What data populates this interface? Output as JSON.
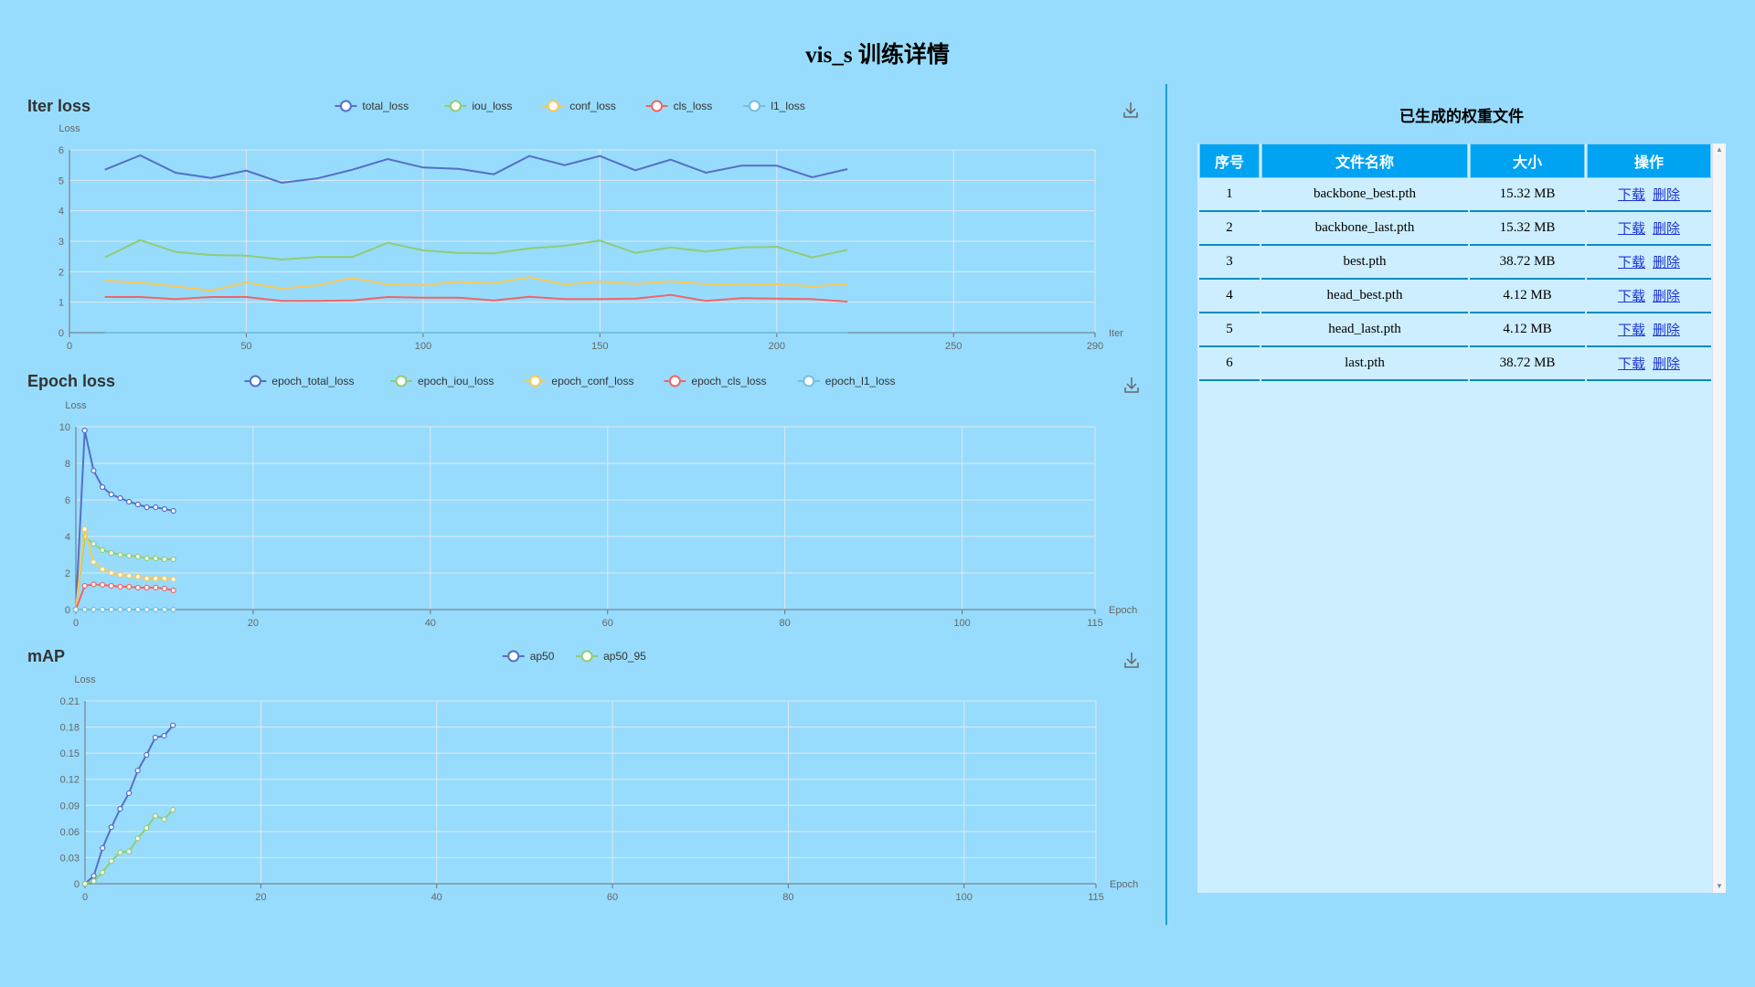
{
  "page": {
    "title": "vis_s 训练详情"
  },
  "colors": {
    "blue": "#5470c6",
    "green": "#91cc75",
    "yellow": "#fac858",
    "red": "#ee6666",
    "cyan": "#73c0de",
    "background": "#97dcfd",
    "header": "#00a3f2"
  },
  "charts": [
    {
      "title": "Iter loss",
      "chart_data": {
        "type": "line",
        "ylabel": "Loss",
        "xlabel": "Iter",
        "x_ticks": [
          "0",
          "50",
          "100",
          "150",
          "200",
          "250",
          "290"
        ],
        "y_ticks": [
          "0",
          "1",
          "2",
          "3",
          "4",
          "5",
          "6"
        ],
        "xlim": [
          0,
          290
        ],
        "ylim": [
          0,
          6
        ],
        "x": [
          10,
          20,
          30,
          40,
          50,
          60,
          70,
          80,
          90,
          100,
          110,
          120,
          130,
          140,
          150,
          160,
          170,
          180,
          190,
          200,
          210,
          220
        ],
        "series": [
          {
            "name": "total_loss",
            "color": "#5470c6",
            "values": [
              5.35,
              5.82,
              5.25,
              5.08,
              5.32,
              4.92,
              5.06,
              5.35,
              5.7,
              5.42,
              5.38,
              5.2,
              5.8,
              5.5,
              5.8,
              5.33,
              5.68,
              5.25,
              5.48,
              5.48,
              5.1,
              5.37
            ]
          },
          {
            "name": "iou_loss",
            "color": "#91cc75",
            "values": [
              2.47,
              3.04,
              2.65,
              2.55,
              2.53,
              2.4,
              2.48,
              2.48,
              2.95,
              2.7,
              2.62,
              2.6,
              2.77,
              2.85,
              3.02,
              2.62,
              2.8,
              2.66,
              2.8,
              2.82,
              2.47,
              2.72
            ]
          },
          {
            "name": "conf_loss",
            "color": "#fac858",
            "values": [
              1.7,
              1.64,
              1.52,
              1.38,
              1.65,
              1.45,
              1.55,
              1.8,
              1.58,
              1.55,
              1.67,
              1.62,
              1.82,
              1.58,
              1.68,
              1.6,
              1.68,
              1.6,
              1.57,
              1.6,
              1.52,
              1.6
            ]
          },
          {
            "name": "cls_loss",
            "color": "#ee6666",
            "values": [
              1.17,
              1.17,
              1.1,
              1.17,
              1.17,
              1.04,
              1.04,
              1.06,
              1.17,
              1.15,
              1.15,
              1.06,
              1.18,
              1.1,
              1.1,
              1.12,
              1.24,
              1.04,
              1.13,
              1.12,
              1.1,
              1.02
            ]
          },
          {
            "name": "l1_loss",
            "color": "#73c0de",
            "values": [
              0,
              0,
              0,
              0,
              0,
              0,
              0,
              0,
              0,
              0,
              0,
              0,
              0,
              0,
              0,
              0,
              0,
              0,
              0,
              0,
              0,
              0
            ]
          }
        ],
        "show_symbols": false
      }
    },
    {
      "title": "Epoch loss",
      "chart_data": {
        "type": "line",
        "ylabel": "Loss",
        "xlabel": "Epoch",
        "x_ticks": [
          "0",
          "20",
          "40",
          "60",
          "80",
          "100",
          "115"
        ],
        "y_ticks": [
          "0",
          "2",
          "4",
          "6",
          "8",
          "10"
        ],
        "xlim": [
          0,
          115
        ],
        "ylim": [
          0,
          10
        ],
        "x": [
          0,
          1,
          2,
          3,
          4,
          5,
          6,
          7,
          8,
          9,
          10,
          11
        ],
        "series": [
          {
            "name": "epoch_total_loss",
            "color": "#5470c6",
            "values": [
              0,
              9.8,
              7.6,
              6.7,
              6.3,
              6.1,
              5.9,
              5.75,
              5.6,
              5.6,
              5.5,
              5.4
            ]
          },
          {
            "name": "epoch_iou_loss",
            "color": "#91cc75",
            "values": [
              0,
              4.0,
              3.6,
              3.25,
              3.1,
              3.0,
              2.95,
              2.9,
              2.8,
              2.8,
              2.75,
              2.75
            ]
          },
          {
            "name": "epoch_conf_loss",
            "color": "#fac858",
            "values": [
              0,
              4.4,
              2.6,
              2.2,
              2.0,
              1.9,
              1.85,
              1.8,
              1.7,
              1.7,
              1.7,
              1.65
            ]
          },
          {
            "name": "epoch_cls_loss",
            "color": "#ee6666",
            "values": [
              0,
              1.3,
              1.38,
              1.35,
              1.3,
              1.25,
              1.25,
              1.2,
              1.2,
              1.2,
              1.15,
              1.05
            ]
          },
          {
            "name": "epoch_l1_loss",
            "color": "#73c0de",
            "values": [
              0,
              0,
              0,
              0,
              0,
              0,
              0,
              0,
              0,
              0,
              0,
              0
            ]
          }
        ],
        "show_symbols": true
      }
    },
    {
      "title": "mAP",
      "chart_data": {
        "type": "line",
        "ylabel": "Loss",
        "xlabel": "Epoch",
        "x_ticks": [
          "0",
          "20",
          "40",
          "60",
          "80",
          "100",
          "115"
        ],
        "y_ticks": [
          "0",
          "0.03",
          "0.06",
          "0.09",
          "0.12",
          "0.15",
          "0.18",
          "0.21"
        ],
        "xlim": [
          0,
          115
        ],
        "ylim": [
          0,
          0.21
        ],
        "x": [
          0,
          1,
          2,
          3,
          4,
          5,
          6,
          7,
          8,
          9,
          10
        ],
        "series": [
          {
            "name": "ap50",
            "color": "#5470c6",
            "values": [
              0,
              0.009,
              0.041,
              0.065,
              0.086,
              0.104,
              0.13,
              0.148,
              0.168,
              0.17,
              0.182
            ]
          },
          {
            "name": "ap50_95",
            "color": "#91cc75",
            "values": [
              0,
              0.003,
              0.013,
              0.026,
              0.036,
              0.037,
              0.052,
              0.064,
              0.078,
              0.074,
              0.085
            ]
          }
        ],
        "show_symbols": true
      }
    }
  ],
  "weights": {
    "title": "已生成的权重文件",
    "headers": [
      "序号",
      "文件名称",
      "大小",
      "操作"
    ],
    "download_label": "下载",
    "delete_label": "删除",
    "rows": [
      {
        "index": "1",
        "name": "backbone_best.pth",
        "size": "15.32 MB"
      },
      {
        "index": "2",
        "name": "backbone_last.pth",
        "size": "15.32 MB"
      },
      {
        "index": "3",
        "name": "best.pth",
        "size": "38.72 MB"
      },
      {
        "index": "4",
        "name": "head_best.pth",
        "size": "4.12 MB"
      },
      {
        "index": "5",
        "name": "head_last.pth",
        "size": "4.12 MB"
      },
      {
        "index": "6",
        "name": "last.pth",
        "size": "38.72 MB"
      }
    ]
  }
}
